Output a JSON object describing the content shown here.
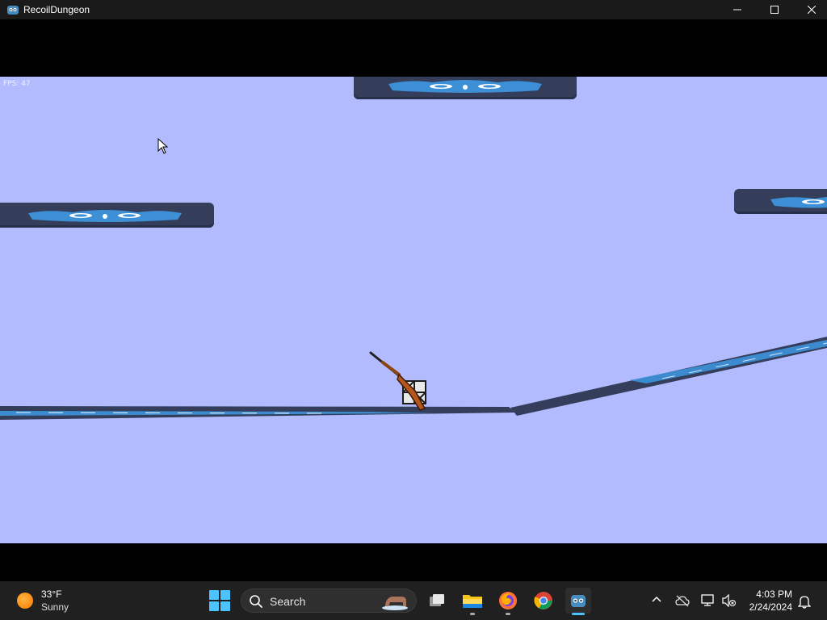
{
  "window": {
    "title": "RecoilDungeon",
    "minimize_icon": "minimize-icon",
    "maximize_icon": "maximize-icon",
    "close_icon": "close-icon"
  },
  "game": {
    "fps_text": "FPS: 47",
    "background_color": "#b3bbff",
    "platform_color": "#343e5a",
    "water_color": "#3d8fd6"
  },
  "taskbar": {
    "weather": {
      "temp": "33°F",
      "condition": "Sunny",
      "icon": "sun-icon"
    },
    "search": {
      "label": "Search"
    },
    "apps": [
      {
        "name": "task-view",
        "icon": "task-view-icon"
      },
      {
        "name": "file-explorer",
        "icon": "folder-icon"
      },
      {
        "name": "firefox",
        "icon": "firefox-icon"
      },
      {
        "name": "chrome",
        "icon": "chrome-icon"
      },
      {
        "name": "godot",
        "icon": "godot-icon"
      }
    ],
    "tray": {
      "show_hidden": "chevron-up-icon",
      "onedrive": "cloud-off-icon",
      "network": "network-icon",
      "volume": "volume-muted-icon",
      "time": "4:03 PM",
      "date": "2/24/2024",
      "notifications": "bell-icon"
    }
  }
}
